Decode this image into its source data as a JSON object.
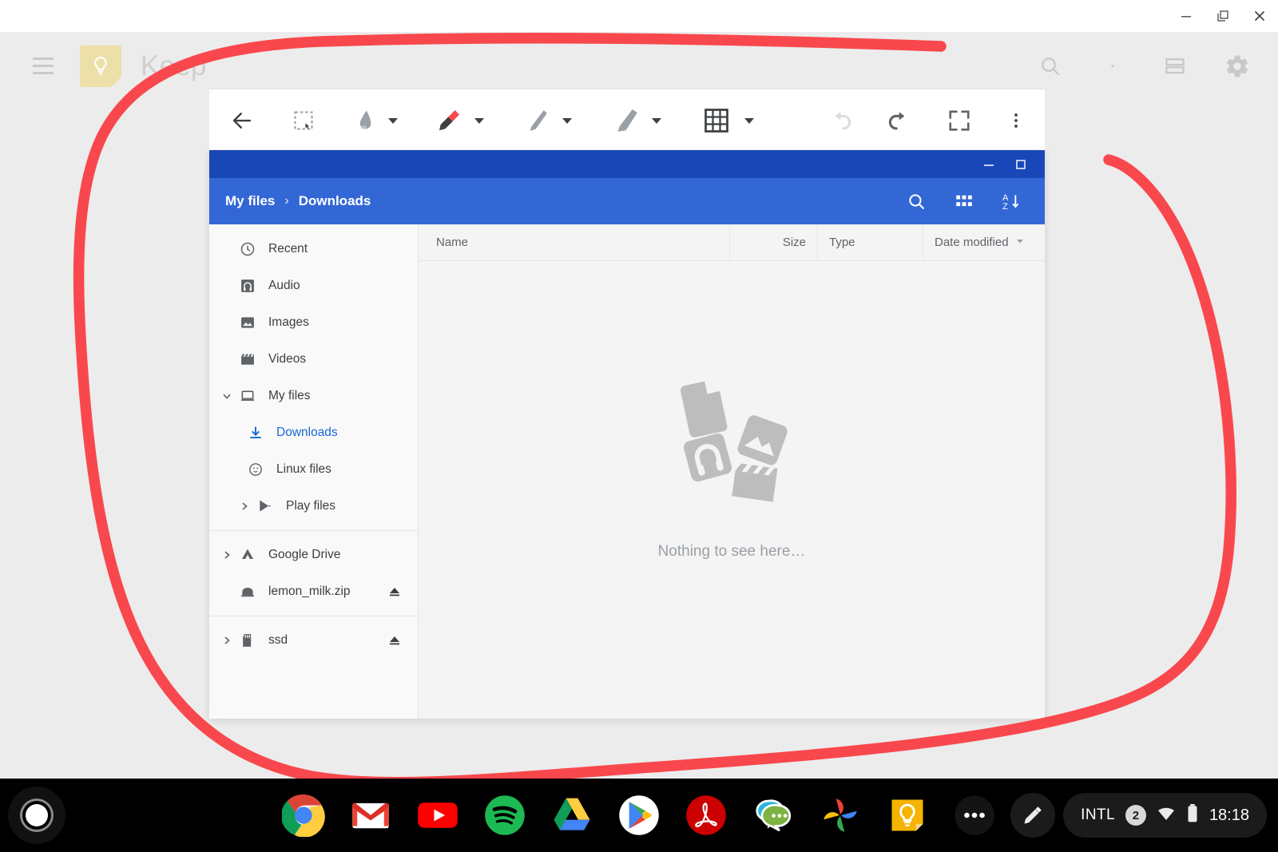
{
  "window_controls": {
    "minimize": "minimize-window",
    "restore": "restore-window",
    "close": "close-window"
  },
  "keep_app": {
    "title": "Keep",
    "menu_label": "Main menu",
    "logo_name": "keep-lightbulb-logo",
    "header_icons": [
      {
        "name": "search-icon",
        "label": "Search"
      },
      {
        "name": "refresh-dot-icon",
        "label": "Refresh"
      },
      {
        "name": "list-view-icon",
        "label": "List view"
      },
      {
        "name": "settings-gear-icon",
        "label": "Settings"
      }
    ]
  },
  "annotation_toolbar": {
    "tools": [
      {
        "name": "back-arrow-icon",
        "label": "Back",
        "caret": false,
        "active": false
      },
      {
        "name": "crop-select-icon",
        "label": "Crop / select",
        "caret": false,
        "active": false
      },
      {
        "name": "eraser-icon",
        "label": "Eraser",
        "caret": true,
        "active": false
      },
      {
        "name": "pen-icon",
        "label": "Pen",
        "caret": true,
        "active": true
      },
      {
        "name": "pencil-icon",
        "label": "Pencil",
        "caret": true,
        "active": false
      },
      {
        "name": "highlighter-icon",
        "label": "Highlighter",
        "caret": true,
        "active": false
      },
      {
        "name": "grid-icon",
        "label": "Grid / templates",
        "caret": true,
        "active": false
      }
    ],
    "actions": [
      {
        "name": "undo-icon",
        "label": "Undo",
        "disabled": true
      },
      {
        "name": "redo-icon",
        "label": "Redo",
        "disabled": false
      },
      {
        "name": "fullscreen-icon",
        "label": "Fullscreen",
        "disabled": false
      },
      {
        "name": "more-vert-icon",
        "label": "More options",
        "disabled": false
      }
    ],
    "active_tool_color": "#F9484D"
  },
  "files_app": {
    "titlebar": {
      "minimize_label": "Minimize",
      "maximize_label": "Maximize"
    },
    "breadcrumb": {
      "root": "My files",
      "separator": "›",
      "current": "Downloads"
    },
    "toolbar_icons": [
      {
        "name": "search-icon",
        "label": "Search"
      },
      {
        "name": "grid-view-icon",
        "label": "Switch to grid view"
      },
      {
        "name": "sort-az-icon",
        "label": "Sort"
      }
    ],
    "sidebar": {
      "items": [
        {
          "label": "Recent",
          "icon": "clock-icon",
          "arrow": "none",
          "indent": false,
          "active": false,
          "eject": false
        },
        {
          "label": "Audio",
          "icon": "audio-icon",
          "arrow": "none",
          "indent": false,
          "active": false,
          "eject": false
        },
        {
          "label": "Images",
          "icon": "image-icon",
          "arrow": "none",
          "indent": false,
          "active": false,
          "eject": false
        },
        {
          "label": "Videos",
          "icon": "video-icon",
          "arrow": "none",
          "indent": false,
          "active": false,
          "eject": false
        },
        {
          "label": "My files",
          "icon": "laptop-icon",
          "arrow": "down",
          "indent": false,
          "active": false,
          "eject": false
        },
        {
          "label": "Downloads",
          "icon": "download-icon",
          "arrow": "none",
          "indent": true,
          "active": true,
          "eject": false
        },
        {
          "label": "Linux files",
          "icon": "linux-penguin-icon",
          "arrow": "none",
          "indent": true,
          "active": false,
          "eject": false
        },
        {
          "label": "Play files",
          "icon": "play-store-icon",
          "arrow": "right",
          "indent": true,
          "active": false,
          "eject": false
        },
        {
          "label": "Google Drive",
          "icon": "google-drive-icon",
          "arrow": "right",
          "indent": false,
          "active": false,
          "eject": false
        },
        {
          "label": "lemon_milk.zip",
          "icon": "archive-icon",
          "arrow": "none",
          "indent": false,
          "active": false,
          "eject": true
        },
        {
          "label": "ssd",
          "icon": "sd-card-icon",
          "arrow": "right",
          "indent": false,
          "active": false,
          "eject": true
        }
      ],
      "divider_after": [
        7,
        9
      ]
    },
    "columns": [
      {
        "key": "name",
        "label": "Name"
      },
      {
        "key": "size",
        "label": "Size"
      },
      {
        "key": "type",
        "label": "Type"
      },
      {
        "key": "date",
        "label": "Date modified"
      }
    ],
    "sorted_column": "Date modified",
    "rows": [],
    "empty_state_text": "Nothing to see here…",
    "empty_state_icons": [
      "document-icon",
      "image-icon",
      "audio-icon",
      "video-clapper-icon"
    ]
  },
  "annotation": {
    "stroke_color": "#F9484D",
    "stroke_width": 13,
    "shape": "hand-drawn-loop"
  },
  "shelf": {
    "launcher_label": "Launcher",
    "apps": [
      {
        "name": "chrome-icon",
        "label": "Google Chrome"
      },
      {
        "name": "gmail-icon",
        "label": "Gmail"
      },
      {
        "name": "youtube-icon",
        "label": "YouTube"
      },
      {
        "name": "spotify-icon",
        "label": "Spotify"
      },
      {
        "name": "google-drive-icon",
        "label": "Google Drive"
      },
      {
        "name": "play-store-icon",
        "label": "Play Store"
      },
      {
        "name": "adobe-acrobat-icon",
        "label": "Adobe Acrobat"
      },
      {
        "name": "messages-icon",
        "label": "Messages"
      },
      {
        "name": "google-photos-icon",
        "label": "Google Photos"
      },
      {
        "name": "keep-icon",
        "label": "Google Keep"
      },
      {
        "name": "overflow-icon",
        "label": "More apps"
      }
    ],
    "tray": {
      "stylus_label": "Stylus tools",
      "input_method": "INTL",
      "notification_count": "2",
      "wifi_label": "Wi-Fi connected",
      "battery_label": "Battery",
      "time": "18:18"
    }
  }
}
